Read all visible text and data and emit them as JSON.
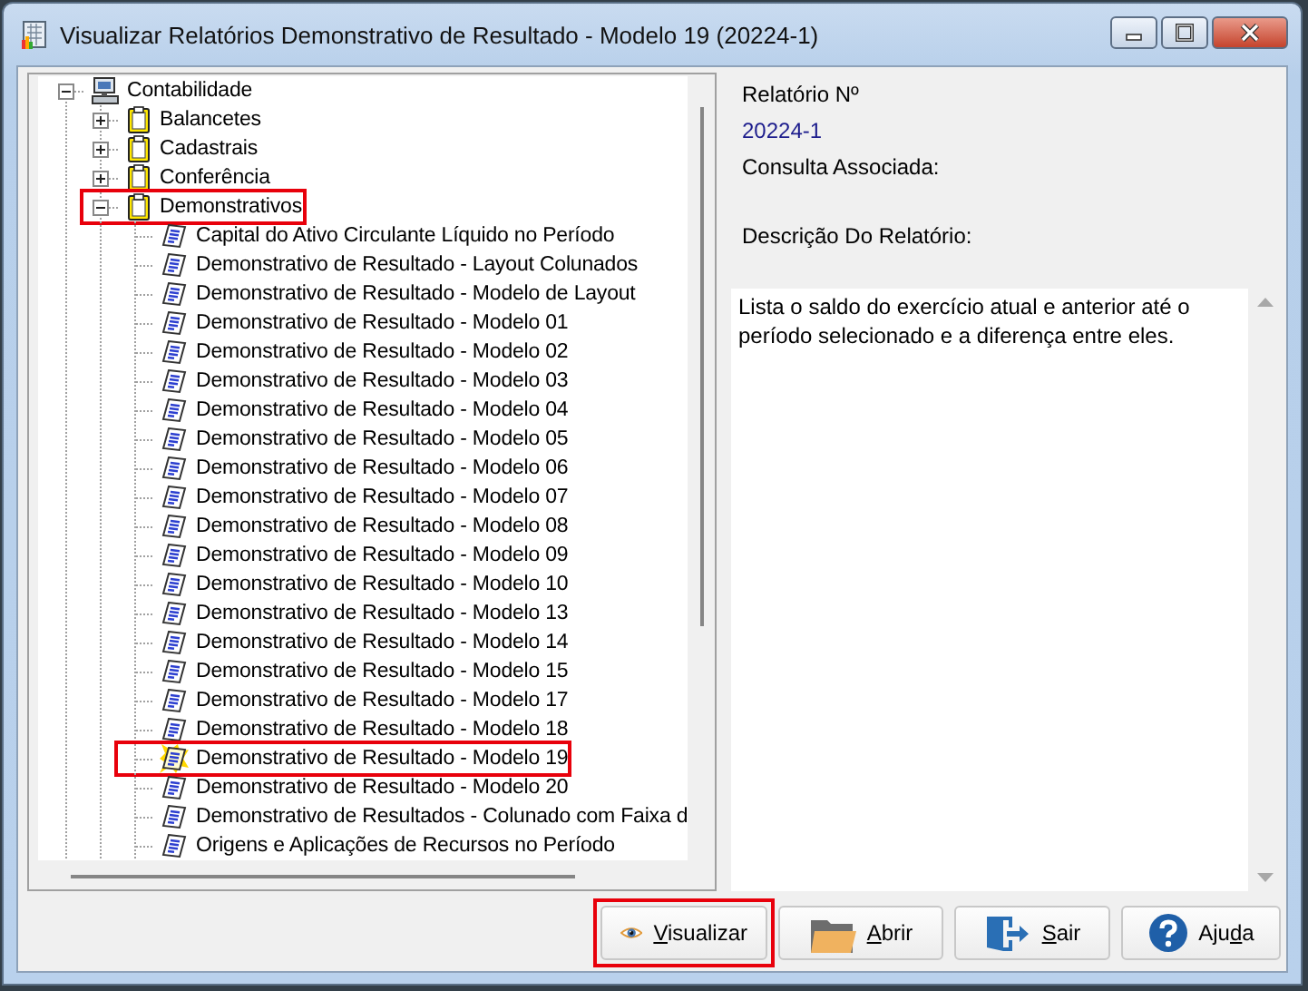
{
  "window": {
    "title": "Visualizar Relatórios Demonstrativo de Resultado - Modelo 19 (20224-1)"
  },
  "tree": {
    "items": [
      {
        "label": "Contabilidade",
        "kind": "computer",
        "expanded": true,
        "highlighted": false,
        "children": [
          {
            "label": "Balancetes",
            "kind": "group",
            "expanded": false,
            "highlighted": false
          },
          {
            "label": "Cadastrais",
            "kind": "group",
            "expanded": false,
            "highlighted": false
          },
          {
            "label": "Conferência",
            "kind": "group",
            "expanded": false,
            "highlighted": false
          },
          {
            "label": "Demonstrativos",
            "kind": "group",
            "expanded": true,
            "highlighted": true,
            "children": [
              {
                "label": "Capital do Ativo Circulante Líquido no Período",
                "kind": "report",
                "selected": false,
                "highlighted": false
              },
              {
                "label": "Demonstrativo de Resultado - Layout Colunados",
                "kind": "report",
                "selected": false,
                "highlighted": false
              },
              {
                "label": "Demonstrativo de Resultado - Modelo de Layout",
                "kind": "report",
                "selected": false,
                "highlighted": false
              },
              {
                "label": "Demonstrativo de Resultado - Modelo 01",
                "kind": "report",
                "selected": false,
                "highlighted": false
              },
              {
                "label": "Demonstrativo de Resultado - Modelo 02",
                "kind": "report",
                "selected": false,
                "highlighted": false
              },
              {
                "label": "Demonstrativo de Resultado - Modelo 03",
                "kind": "report",
                "selected": false,
                "highlighted": false
              },
              {
                "label": "Demonstrativo de Resultado - Modelo 04",
                "kind": "report",
                "selected": false,
                "highlighted": false
              },
              {
                "label": "Demonstrativo de Resultado - Modelo 05",
                "kind": "report",
                "selected": false,
                "highlighted": false
              },
              {
                "label": "Demonstrativo de Resultado - Modelo 06",
                "kind": "report",
                "selected": false,
                "highlighted": false
              },
              {
                "label": "Demonstrativo de Resultado - Modelo 07",
                "kind": "report",
                "selected": false,
                "highlighted": false
              },
              {
                "label": "Demonstrativo de Resultado - Modelo 08",
                "kind": "report",
                "selected": false,
                "highlighted": false
              },
              {
                "label": "Demonstrativo de Resultado - Modelo 09",
                "kind": "report",
                "selected": false,
                "highlighted": false
              },
              {
                "label": "Demonstrativo de Resultado - Modelo 10",
                "kind": "report",
                "selected": false,
                "highlighted": false
              },
              {
                "label": "Demonstrativo de Resultado - Modelo 13",
                "kind": "report",
                "selected": false,
                "highlighted": false
              },
              {
                "label": "Demonstrativo de Resultado - Modelo 14",
                "kind": "report",
                "selected": false,
                "highlighted": false
              },
              {
                "label": "Demonstrativo de Resultado - Modelo 15",
                "kind": "report",
                "selected": false,
                "highlighted": false
              },
              {
                "label": "Demonstrativo de Resultado - Modelo 17",
                "kind": "report",
                "selected": false,
                "highlighted": false
              },
              {
                "label": "Demonstrativo de Resultado - Modelo 18",
                "kind": "report",
                "selected": false,
                "highlighted": false
              },
              {
                "label": "Demonstrativo de Resultado - Modelo 19",
                "kind": "report",
                "selected": true,
                "highlighted": true
              },
              {
                "label": "Demonstrativo de Resultado - Modelo 20",
                "kind": "report",
                "selected": false,
                "highlighted": false
              },
              {
                "label": "Demonstrativo de Resultados - Colunado com Faixa d",
                "kind": "report",
                "selected": false,
                "highlighted": false
              },
              {
                "label": "Origens e Aplicações de Recursos no Período",
                "kind": "report",
                "selected": false,
                "highlighted": false
              }
            ]
          }
        ]
      }
    ]
  },
  "details": {
    "report_number_label": "Relatório Nº",
    "report_number": "20224-1",
    "query_label": "Consulta Associada:",
    "description_label": "Descrição Do Relatório:",
    "description": "Lista o saldo do exercício atual e anterior até o período selecionado e a diferença entre eles."
  },
  "buttons": [
    {
      "kind": "view",
      "key": "V",
      "after": "isualizar",
      "highlighted": true
    },
    {
      "kind": "open",
      "key": "A",
      "after": "brir",
      "highlighted": false
    },
    {
      "kind": "exit",
      "key": "S",
      "after": "air",
      "highlighted": false
    },
    {
      "kind": "help",
      "before": "Aju",
      "key": "d",
      "after": "a",
      "highlighted": false
    }
  ]
}
